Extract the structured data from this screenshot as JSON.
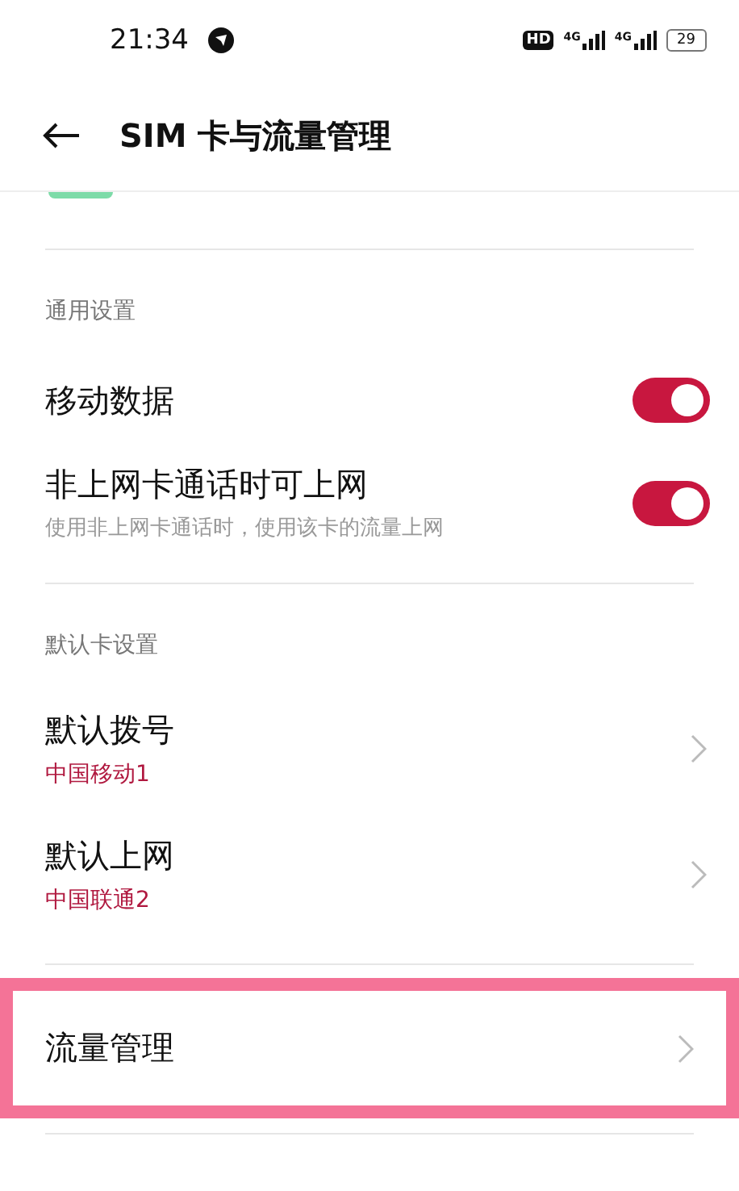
{
  "status_bar": {
    "time": "21:34",
    "hd": "HD",
    "networks": [
      "4G",
      "4G"
    ],
    "battery": "29"
  },
  "header": {
    "title": "SIM 卡与流量管理"
  },
  "sections": [
    {
      "title": "通用设置",
      "items": [
        {
          "kind": "toggle",
          "label": "移动数据",
          "on": true
        },
        {
          "kind": "toggle",
          "label": "非上网卡通话时可上网",
          "subtitle": "使用非上网卡通话时，使用该卡的流量上网",
          "on": true
        }
      ]
    },
    {
      "title": "默认卡设置",
      "items": [
        {
          "kind": "nav",
          "label": "默认拨号",
          "value": "中国移动1",
          "highlighted": false
        },
        {
          "kind": "nav",
          "label": "默认上网",
          "value": "中国联通2",
          "highlighted": false
        }
      ]
    },
    {
      "items": [
        {
          "kind": "nav",
          "label": "流量管理",
          "highlighted": true
        }
      ]
    }
  ]
}
